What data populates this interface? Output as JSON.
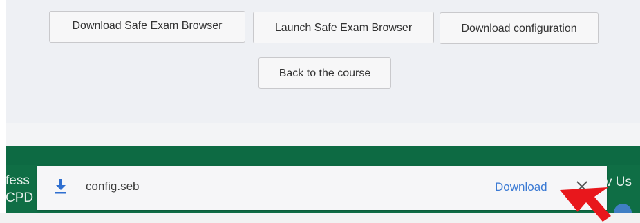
{
  "page": {
    "buttons": {
      "download_seb": "Download Safe Exam Browser",
      "launch_seb": "Launch Safe Exam Browser",
      "download_config": "Download configuration",
      "back_to_course": "Back to the course"
    },
    "footer": {
      "left_text_line1": "fess",
      "left_text_line2": "CPD",
      "right_text": "v Us",
      "color": "#0f6e45"
    }
  },
  "download_bar": {
    "icon": "download-arrow-icon",
    "filename": "config.seb",
    "action_label": "Download",
    "close_icon": "close-icon",
    "accent_color": "#3b7ad4"
  },
  "annotation": {
    "icon": "red-arrow-pointer",
    "color": "#e8171c"
  }
}
